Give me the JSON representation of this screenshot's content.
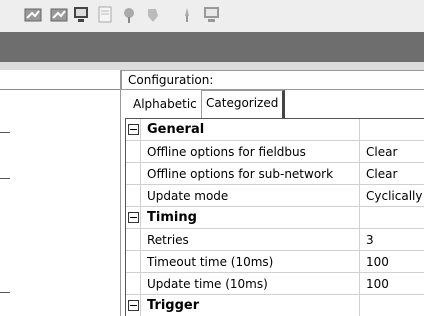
{
  "toolbar": {
    "icons": [
      "network-icon",
      "network-icon",
      "monitor-icon",
      "document-icon",
      "pin-icon",
      "pin-icon",
      "pointer-icon",
      "monitor-icon"
    ]
  },
  "config": {
    "title": "Configuration:",
    "tabs": {
      "alphabetic": "Alphabetic",
      "categorized": "Categorized"
    }
  },
  "grid": {
    "categories": [
      {
        "name": "General",
        "rows": [
          {
            "name": "Offline options for fieldbus",
            "value": "Clear"
          },
          {
            "name": "Offline options for sub-network",
            "value": "Clear"
          },
          {
            "name": "Update mode",
            "value": "Cyclically"
          }
        ]
      },
      {
        "name": "Timing",
        "rows": [
          {
            "name": "Retries",
            "value": "3"
          },
          {
            "name": "Timeout time (10ms)",
            "value": "100"
          },
          {
            "name": "Update time (10ms)",
            "value": "100"
          }
        ]
      },
      {
        "name": "Trigger",
        "rows": []
      }
    ]
  },
  "colors": {
    "dark_band": "#6e6e6e",
    "toolbar_bg": "#eeeeee"
  }
}
